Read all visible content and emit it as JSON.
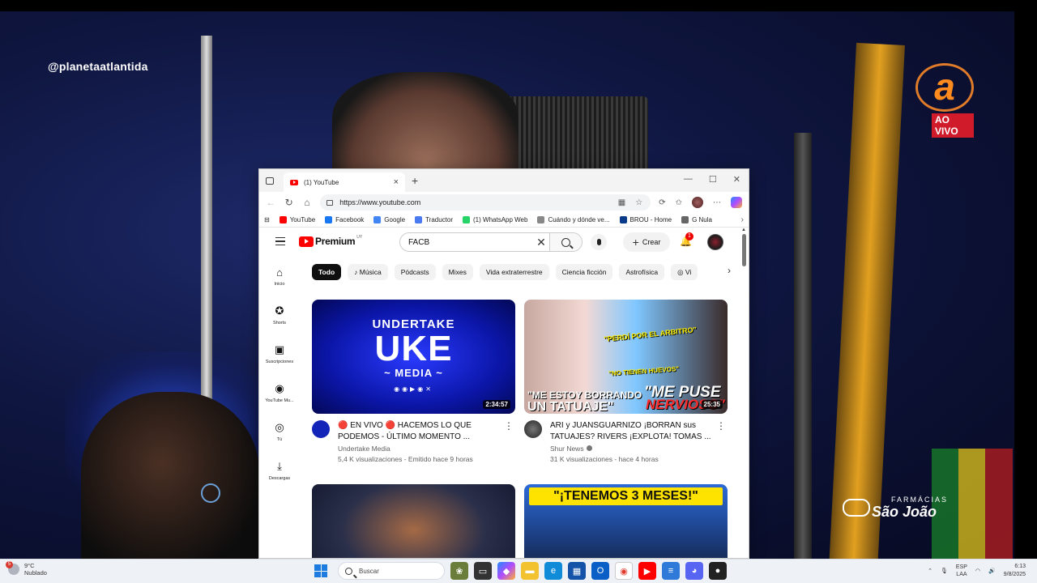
{
  "overlay": {
    "handle": "@planetaatlantida",
    "logo_letter": "a",
    "live_label": "AO VIVO",
    "sponsor_top": "FARMÁCIAS",
    "sponsor_main": "São João"
  },
  "browser": {
    "tab_title": "(1) YouTube",
    "url": "https://www.youtube.com",
    "win_controls": [
      "—",
      "☐",
      "✕"
    ],
    "bookmarks": [
      {
        "label": "YouTube",
        "color": "#ff0000"
      },
      {
        "label": "Facebook",
        "color": "#1877f2"
      },
      {
        "label": "Google",
        "color": "#4285f4"
      },
      {
        "label": "Traductor",
        "color": "#4a7af0"
      },
      {
        "label": "(1) WhatsApp Web",
        "color": "#25d366"
      },
      {
        "label": "Cuándo y dónde ve...",
        "color": "#888888"
      },
      {
        "label": "BROU - Home",
        "color": "#0a3a8a"
      },
      {
        "label": "G Nula",
        "color": "#666666"
      }
    ]
  },
  "youtube": {
    "brand": "Premium",
    "country": "UY",
    "search_query": "FACB",
    "create_label": "Crear",
    "notif_count": "1",
    "nav": [
      {
        "label": "Inicio",
        "icon": "⌂"
      },
      {
        "label": "Shorts",
        "icon": "✪"
      },
      {
        "label": "Suscripciones",
        "icon": "▣"
      },
      {
        "label": "YouTube Mu...",
        "icon": "◉"
      },
      {
        "label": "Tú",
        "icon": "◎"
      },
      {
        "label": "Descargas",
        "icon": "⤓"
      }
    ],
    "chips": [
      "Todo",
      "♪ Música",
      "Pódcasts",
      "Mixes",
      "Vida extraterrestre",
      "Ciencia ficción",
      "Astrofísica",
      "◎ Vi"
    ],
    "videos": [
      {
        "title": "🔴 EN VIVO 🔴 HACEMOS LO QUE PODEMOS - ÚLTIMO MOMENTO ...",
        "channel": "Undertake Media",
        "stats": "5,4 K visualizaciones - Emitido hace 9 horas",
        "duration": "2:34:57",
        "thumb_text": {
          "l1": "UNDERTAKE",
          "l2": "UKE",
          "l3": "~ MEDIA ~",
          "social": "◉◉▶◉✕"
        }
      },
      {
        "title": "ARI y JUANSGUARNIZO ¡BORRAN sus TATUAJES? RIVERS ¡EXPLOTA! TOMAS ...",
        "channel": "Shur News",
        "stats": "31 K visualizaciones - hace 4 horas",
        "duration": "25:35",
        "thumb_text": {
          "b1": "\"PERDÍ POR EL ARBITRO\"",
          "b2": "\"NO TIENEN HUEVOS\"",
          "t1": "\"ME ESTOY BORRANDO",
          "t2": "UN TATUAJE\"",
          "t3": "\"ME PUSE",
          "t4": "NERVIOSO\""
        }
      },
      {
        "title": "",
        "channel": "",
        "stats": "",
        "duration": ""
      },
      {
        "title": "",
        "channel": "",
        "stats": "",
        "duration": "",
        "thumb_text": {
          "banner": "\"¡TENEMOS 3 MESES!\""
        }
      }
    ]
  },
  "taskbar": {
    "weather_temp": "9°C",
    "weather_desc": "Nublado",
    "weather_badge": "5",
    "search_placeholder": "Buscar",
    "lang_top": "ESP",
    "lang_bottom": "LAA",
    "time": "6:13",
    "date": "9/8/2025"
  }
}
